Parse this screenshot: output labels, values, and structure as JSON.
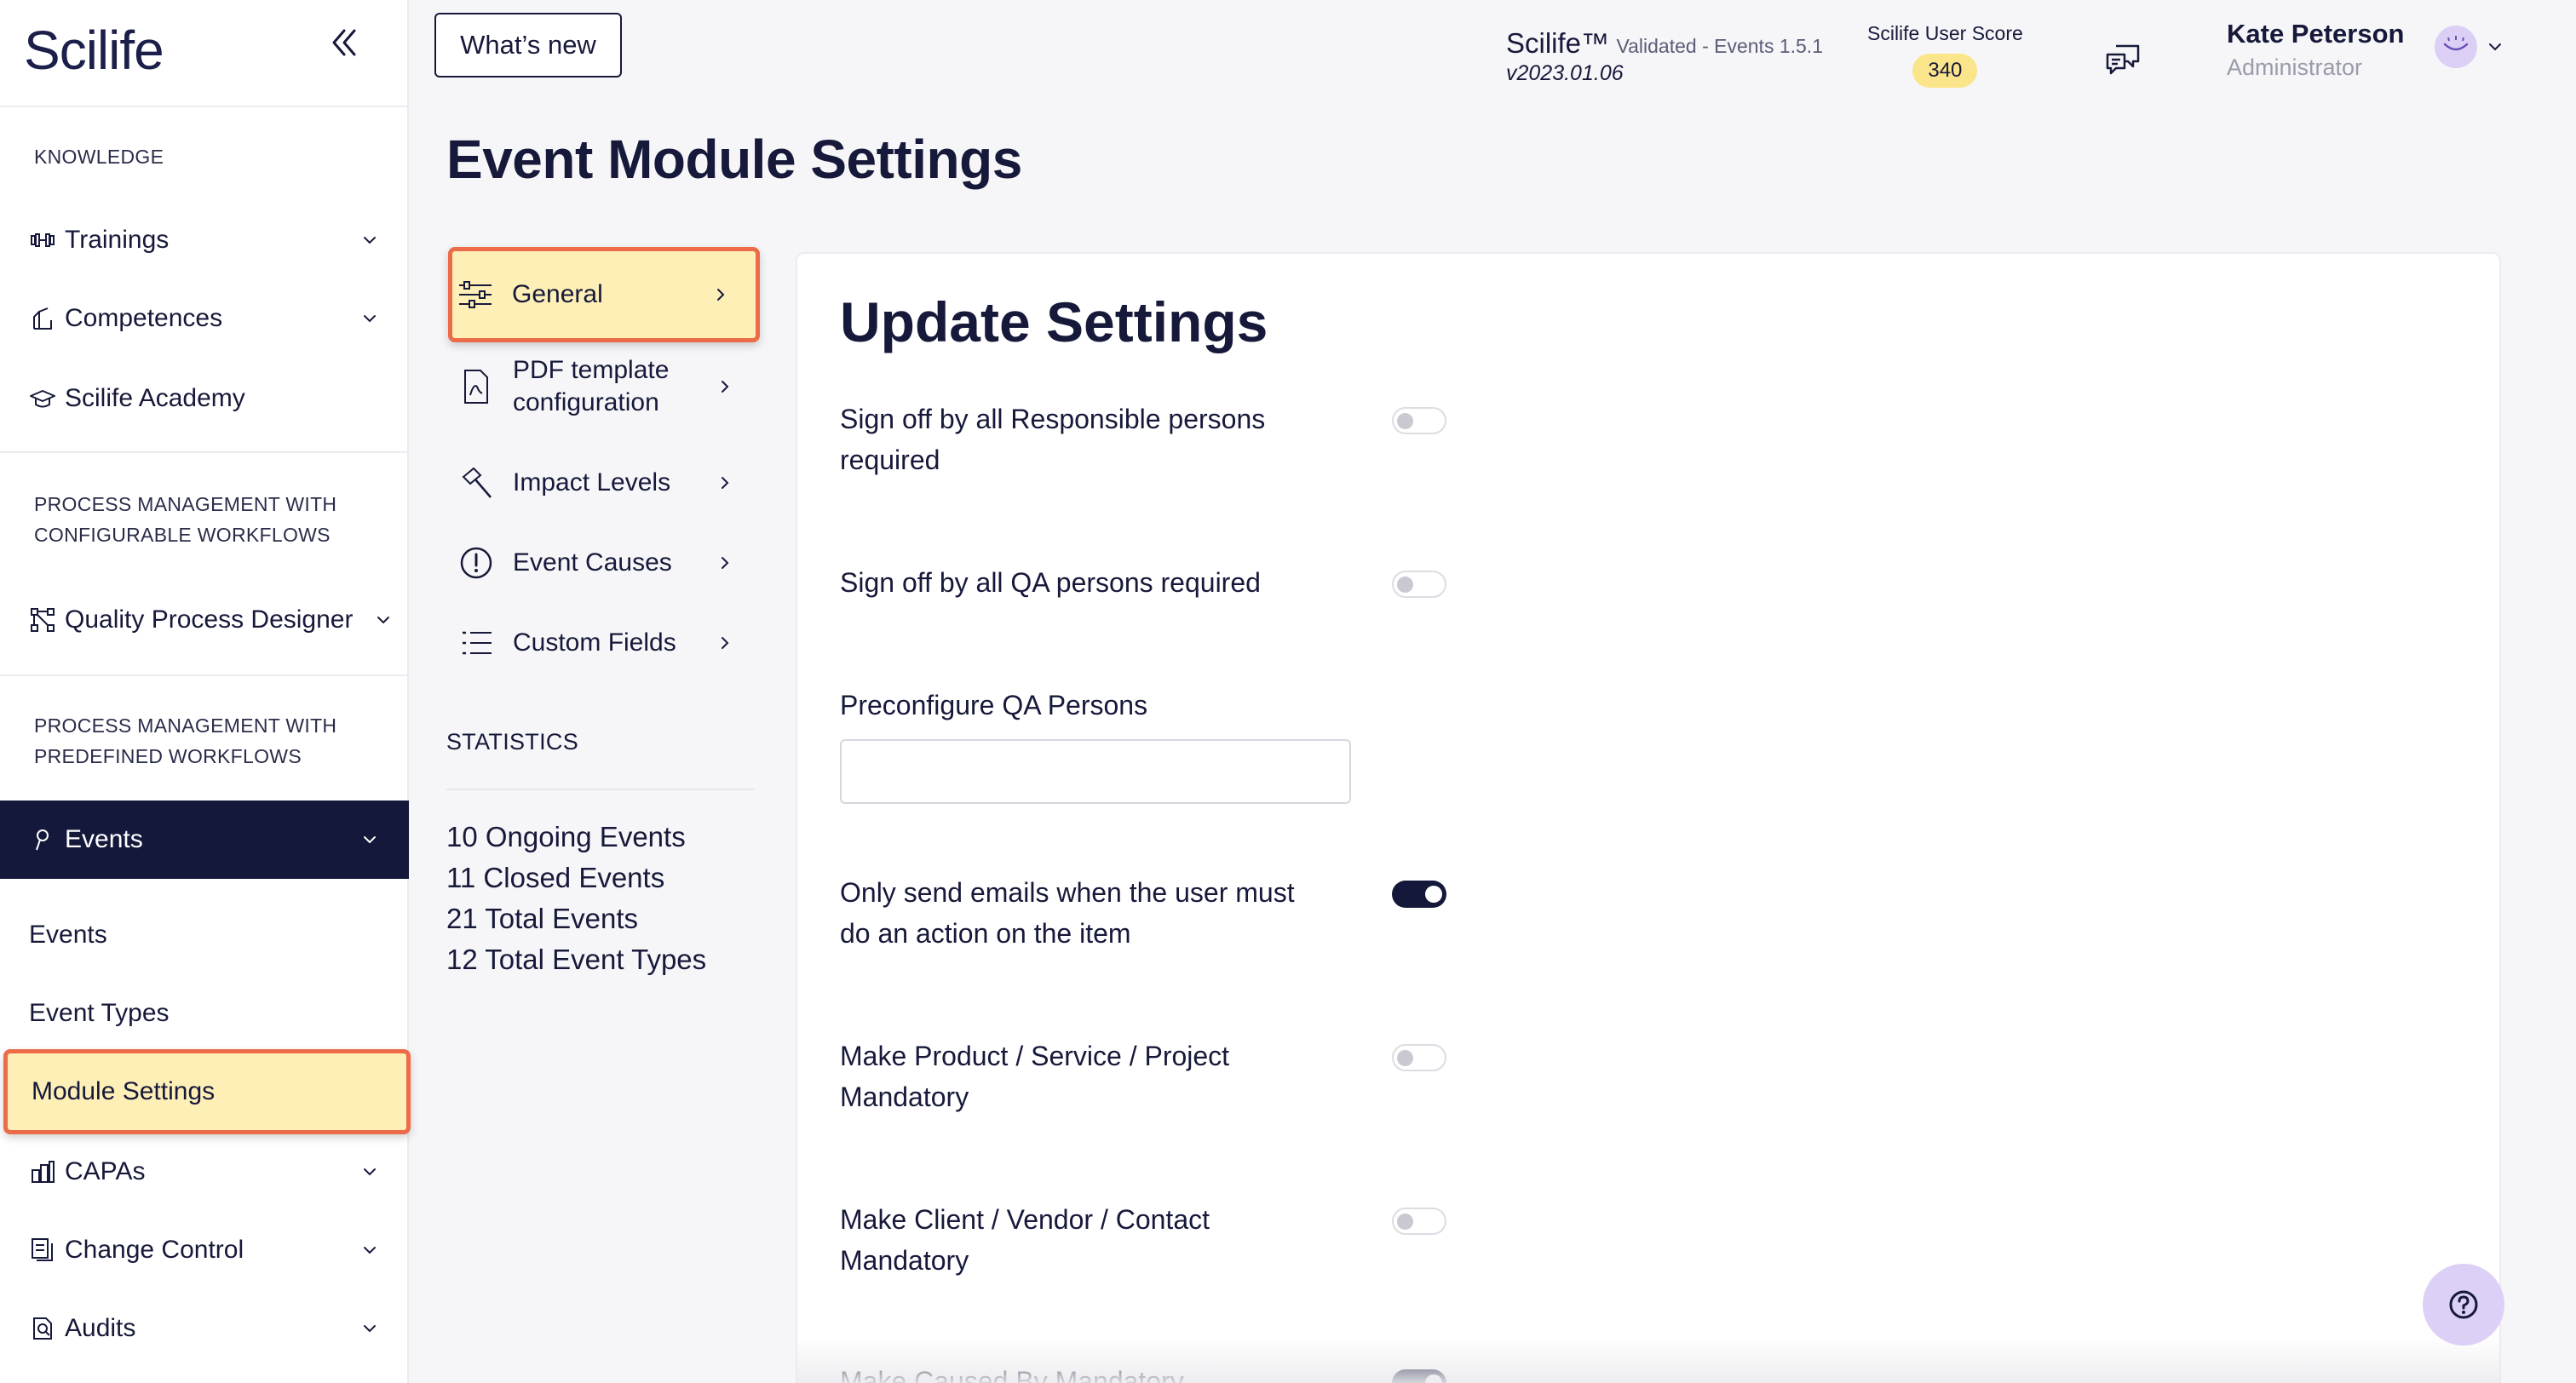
{
  "brand": "Scilife",
  "header": {
    "whats_new": "What’s new",
    "product": "Scilife™",
    "validated": "Validated - Events 1.5.1",
    "version": "v2023.01.06",
    "score_label": "Scilife User Score",
    "score_value": "340",
    "user_name": "Kate Peterson",
    "user_role": "Administrator"
  },
  "sidebar": {
    "section_knowledge": "KNOWLEDGE",
    "trainings": "Trainings",
    "competences": "Competences",
    "academy": "Scilife Academy",
    "section_configurable_1": "PROCESS MANAGEMENT WITH",
    "section_configurable_2": "CONFIGURABLE WORKFLOWS",
    "quality_process_designer": "Quality Process Designer",
    "section_predefined_1": "PROCESS MANAGEMENT WITH",
    "section_predefined_2": "PREDEFINED WORKFLOWS",
    "events": "Events",
    "sub_events": "Events",
    "sub_event_types": "Event Types",
    "sub_module_settings": "Module Settings",
    "capas": "CAPAs",
    "change_control": "Change Control",
    "audits": "Audits"
  },
  "page": {
    "title": "Event Module Settings"
  },
  "settings_nav": {
    "general": "General",
    "pdf_template_1": "PDF template",
    "pdf_template_2": "configuration",
    "impact_levels": "Impact Levels",
    "event_causes": "Event Causes",
    "custom_fields": "Custom Fields"
  },
  "statistics": {
    "title": "STATISTICS",
    "ongoing": "10 Ongoing Events",
    "closed": "11 Closed Events",
    "total": "21 Total Events",
    "types": "12 Total Event Types"
  },
  "update_settings": {
    "title": "Update Settings",
    "s1_line1": "Sign off by all Responsible persons",
    "s1_line2": "required",
    "s1_enabled": false,
    "s2": "Sign off by all QA persons required",
    "s2_enabled": false,
    "qa_label": "Preconfigure QA Persons",
    "qa_value": "",
    "s3_line1": "Only send emails when the user must",
    "s3_line2": "do an action on the item",
    "s3_enabled": true,
    "s4_line1": "Make Product / Service / Project",
    "s4_line2": "Mandatory",
    "s4_enabled": false,
    "s5_line1": "Make Client / Vendor / Contact",
    "s5_line2": "Mandatory",
    "s5_enabled": false,
    "s6": "Make Caused By Mandatory",
    "s6_enabled": true
  },
  "colors": {
    "navy": "#14183a",
    "highlight_fill": "#fdefb6",
    "highlight_border": "#ec6b48",
    "score_badge": "#fbe58a",
    "help_button": "#ddd0f7"
  }
}
